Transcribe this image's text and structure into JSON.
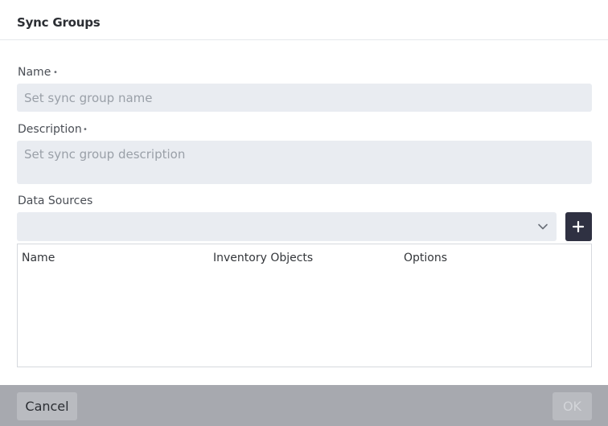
{
  "header": {
    "title": "Sync Groups"
  },
  "form": {
    "name": {
      "label": "Name",
      "required_mark": "•",
      "value": "",
      "placeholder": "Set sync group name"
    },
    "description": {
      "label": "Description",
      "required_mark": "•",
      "value": "",
      "placeholder": "Set sync group description"
    },
    "data_sources": {
      "label": "Data Sources",
      "selected": "",
      "add_icon": "plus-icon",
      "dropdown_icon": "chevron-down-icon"
    }
  },
  "table": {
    "columns": [
      "Name",
      "Inventory Objects",
      "Options"
    ],
    "rows": []
  },
  "footer": {
    "cancel_label": "Cancel",
    "ok_label": "OK"
  },
  "colors": {
    "add_button": "#2f3142",
    "input_bg": "#e9ecf1",
    "footer_bg": "#a7a9af"
  }
}
